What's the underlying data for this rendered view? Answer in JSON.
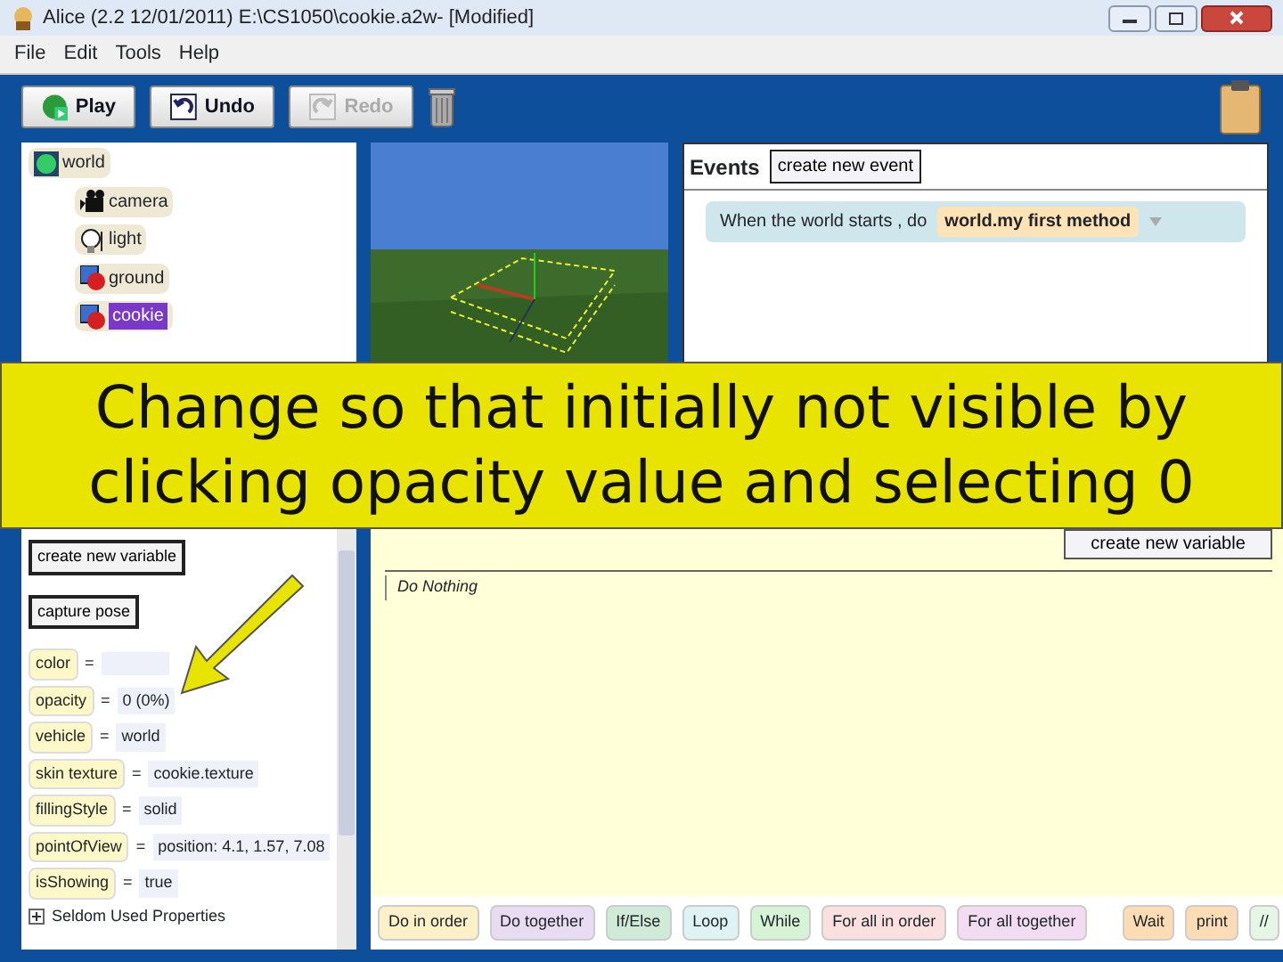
{
  "window": {
    "title": "Alice (2.2  12/01/2011) E:\\CS1050\\cookie.a2w-  [Modified]"
  },
  "menu": [
    "File",
    "Edit",
    "Tools",
    "Help"
  ],
  "toolbar": [
    {
      "label": "Play",
      "kind": "play",
      "disabled": false
    },
    {
      "label": "Undo",
      "kind": "undo",
      "disabled": false
    },
    {
      "label": "Redo",
      "kind": "redo",
      "disabled": true
    }
  ],
  "object_tree": {
    "label": "world",
    "kind": "world",
    "selected": false,
    "children": [
      {
        "label": "camera",
        "kind": "camera",
        "selected": false
      },
      {
        "label": "light",
        "kind": "light",
        "selected": false
      },
      {
        "label": "ground",
        "kind": "model",
        "selected": false
      },
      {
        "label": "cookie",
        "kind": "model",
        "selected": true
      }
    ]
  },
  "events": {
    "title": "Events",
    "button": "create new event",
    "items": [
      {
        "text": "When the world starts ,  do",
        "method": "world.my first method"
      }
    ]
  },
  "caption": "Change so that initially not visible by clicking opacity value and selecting 0",
  "properties": {
    "buttons": [
      "create new variable",
      "capture pose"
    ],
    "items": [
      {
        "name": "color",
        "operator": "="
      },
      {
        "name": "opacity",
        "operator": "=",
        "value": "0 (0%)"
      },
      {
        "name": "vehicle",
        "operator": "=",
        "value": "world"
      },
      {
        "name": "skin texture",
        "operator": "=",
        "value": "cookie.texture"
      },
      {
        "name": "fillingStyle",
        "operator": "=",
        "value": "solid"
      },
      {
        "name": "pointOfView",
        "operator": "=",
        "value": "position: 4.1, 1.57, 7.08"
      },
      {
        "name": "isShowing",
        "operator": "=",
        "value": "true"
      }
    ],
    "more": "Seldom Used Properties"
  },
  "method_editor": {
    "button": "create new variable",
    "body": "Do Nothing"
  },
  "tiles": [
    {
      "label": "Do in order",
      "color": "#fcf0c8"
    },
    {
      "label": "Do together",
      "color": "#e8dcf2"
    },
    {
      "label": "If/Else",
      "color": "#cfead6"
    },
    {
      "label": "Loop",
      "color": "#dff3f4"
    },
    {
      "label": "While",
      "color": "#d6f3d6"
    },
    {
      "label": "For all in order",
      "color": "#fbe0e0"
    },
    {
      "label": "For all together",
      "color": "#f1dcf1"
    },
    {
      "label": "Wait",
      "color": "#fcdcb4"
    },
    {
      "label": "print",
      "color": "#fcdcb4"
    },
    {
      "label": "//",
      "color": "#e6f6e4"
    }
  ]
}
